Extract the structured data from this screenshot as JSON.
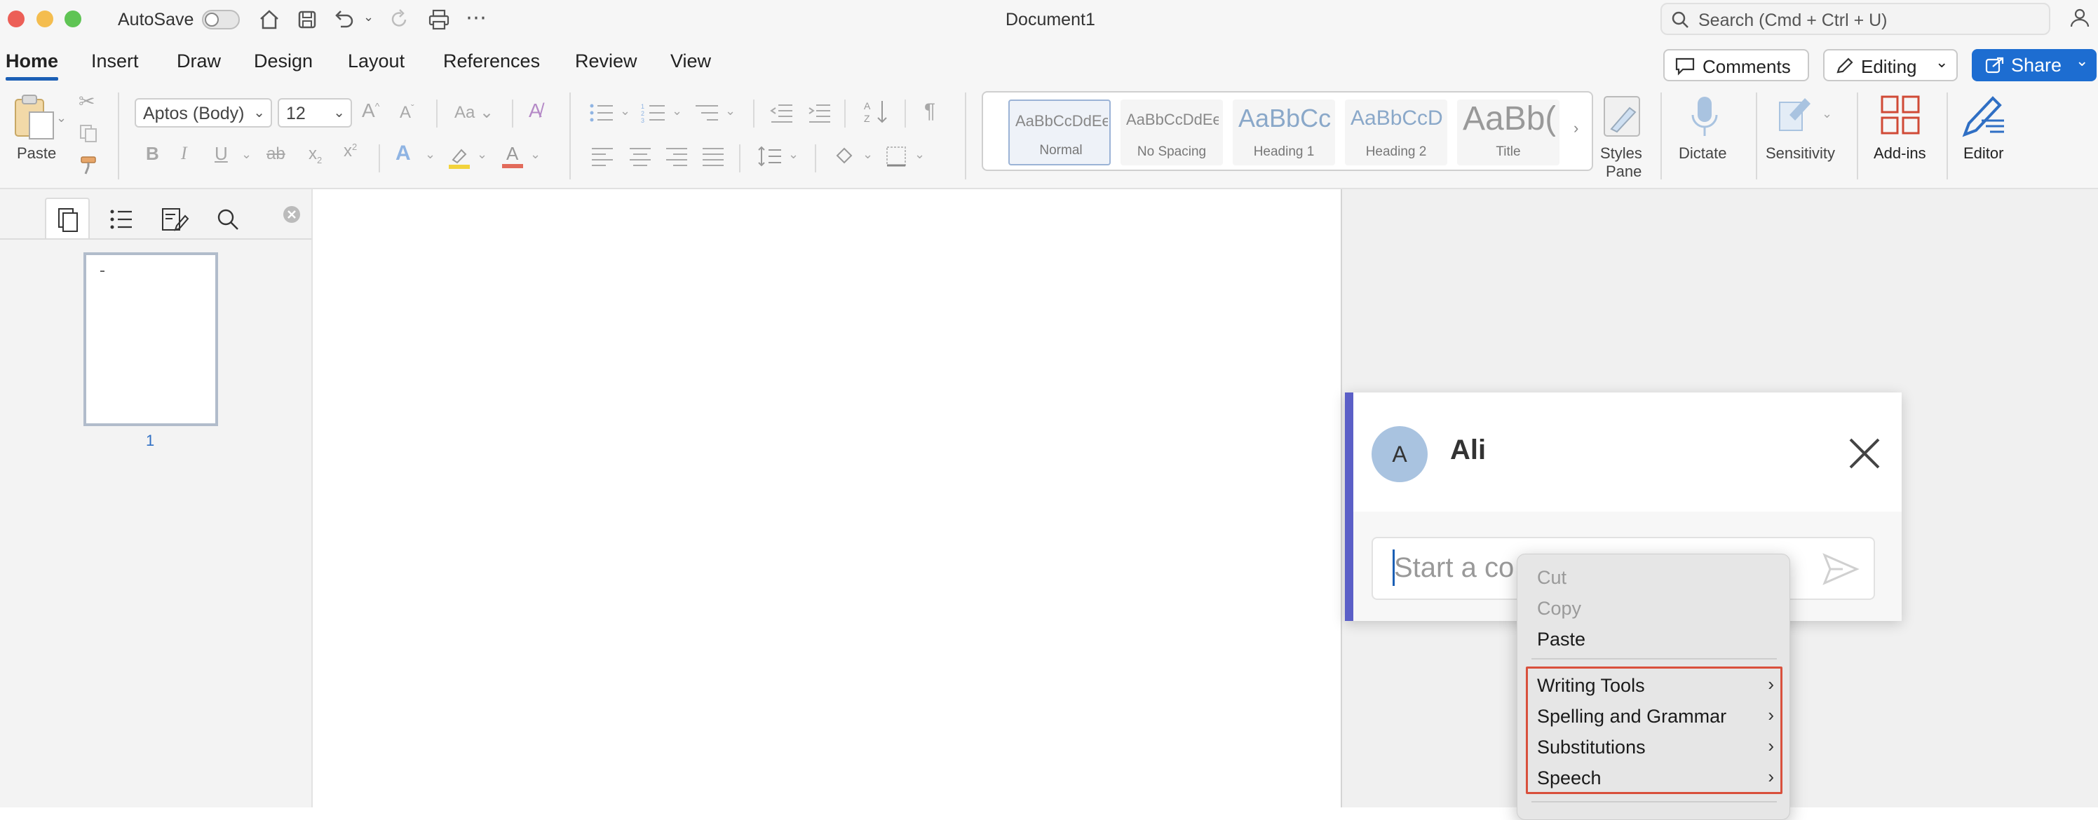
{
  "titlebar": {
    "autosave_label": "AutoSave",
    "autosave_state": "off",
    "document_title": "Document1",
    "search_placeholder": "Search (Cmd + Ctrl + U)"
  },
  "tabs": [
    {
      "label": "Home",
      "active": true
    },
    {
      "label": "Insert"
    },
    {
      "label": "Draw"
    },
    {
      "label": "Design"
    },
    {
      "label": "Layout"
    },
    {
      "label": "References"
    },
    {
      "label": "Review"
    },
    {
      "label": "View"
    }
  ],
  "header_buttons": {
    "comments": "Comments",
    "editing": "Editing",
    "share": "Share"
  },
  "ribbon": {
    "paste_label": "Paste",
    "font_name": "Aptos (Body)",
    "font_size": "12",
    "styles": [
      {
        "sample": "AaBbCcDdEe",
        "name": "Normal",
        "selected": true
      },
      {
        "sample": "AaBbCcDdEe",
        "name": "No Spacing"
      },
      {
        "sample": "AaBbCc",
        "name": "Heading 1"
      },
      {
        "sample": "AaBbCcDd",
        "name": "Heading 2"
      },
      {
        "sample": "AaBb(",
        "name": "Title"
      }
    ],
    "styles_pane_label_1": "Styles",
    "styles_pane_label_2": "Pane",
    "dictate_label": "Dictate",
    "sensitivity_label": "Sensitivity",
    "addins_label": "Add-ins",
    "editor_label": "Editor"
  },
  "navpane": {
    "page_number": "1"
  },
  "comment": {
    "avatar_initial": "A",
    "author": "Ali",
    "input_placeholder": "Start a co"
  },
  "context_menu": {
    "items": [
      {
        "label": "Cut",
        "enabled": false
      },
      {
        "label": "Copy",
        "enabled": false
      },
      {
        "label": "Paste",
        "enabled": true
      },
      {
        "label": "Writing Tools",
        "submenu": true
      },
      {
        "label": "Spelling and Grammar",
        "submenu": true
      },
      {
        "label": "Substitutions",
        "submenu": true
      },
      {
        "label": "Speech",
        "submenu": true
      }
    ],
    "highlight_color": "#d9503c"
  },
  "colors": {
    "accent_blue": "#1d6dd1",
    "comment_accent": "#5b5fc7",
    "highlight_yellow": "#f2d33c",
    "font_color_red": "#e26b5b",
    "addins_red": "#d04a36"
  }
}
